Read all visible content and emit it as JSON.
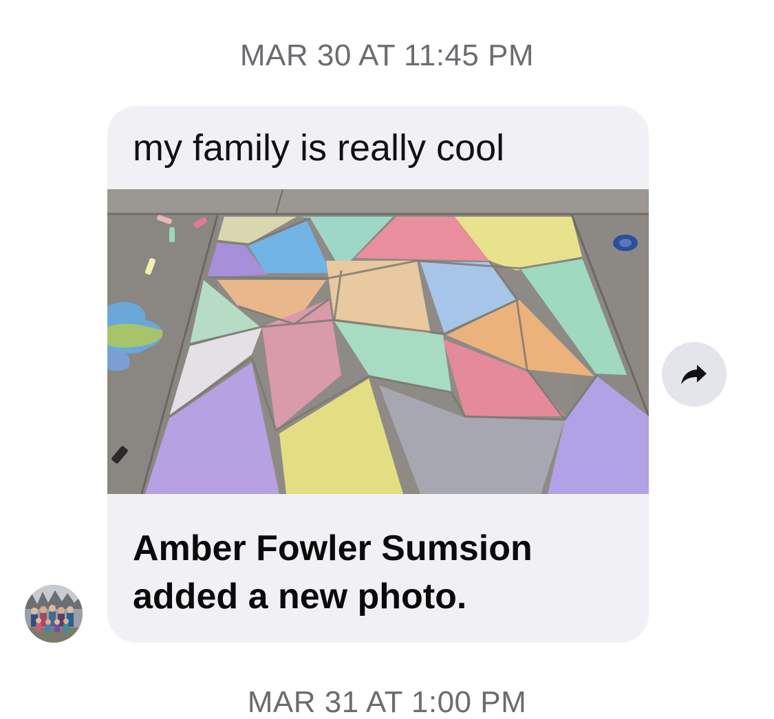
{
  "thread": {
    "timestamp_top": "MAR 30 AT 11:45 PM",
    "timestamp_bottom": "MAR 31 AT 1:00 PM"
  },
  "message": {
    "text": "my family is really cool",
    "share_caption": "Amber Fowler Sumsion added a new photo.",
    "photo_icon": "chalk-art-photo"
  },
  "actions": {
    "forward_icon": "forward-arrow-icon"
  },
  "sender": {
    "avatar_icon": "family-group-avatar"
  }
}
